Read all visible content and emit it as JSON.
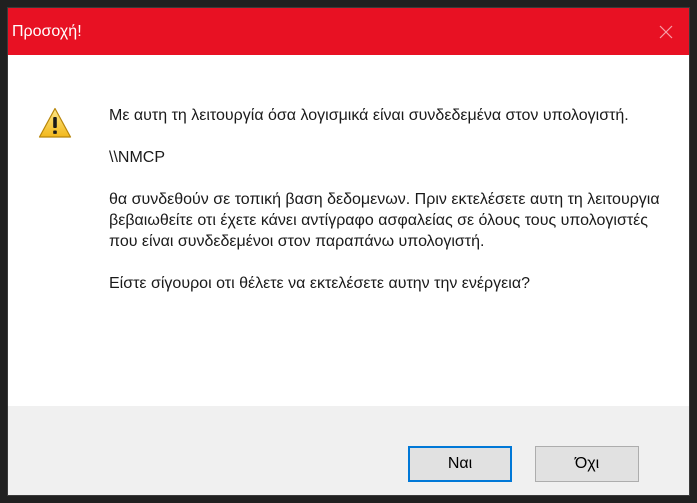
{
  "dialog": {
    "title": "Προσοχή!",
    "colors": {
      "titlebar": "#e81123",
      "title_text": "#ffffff",
      "footer": "#f0f0f0",
      "focus_border": "#0078d7"
    },
    "icon": "warning-icon",
    "message": {
      "line1": "Με αυτη τη λειτουργία όσα λογισμικά είναι συνδεδεμένα στον υπολογιστή.",
      "line2": "\\\\NMCP",
      "line3": "θα συνδεθούν σε τοπική βαση δεδομενων. Πριν εκτελέσετε αυτη τη λειτουργια βεβαιωθείτε οτι έχετε κάνει αντίγραφο ασφαλείας σε όλους τους υπολογιστές που είναι συνδεδεμένοι στον παραπάνω υπολογιστή.",
      "line4": "Είστε σίγουροι οτι θέλετε να εκτελέσετε αυτην την ενέργεια?"
    },
    "buttons": {
      "yes": "Ναι",
      "no": "Όχι"
    }
  }
}
